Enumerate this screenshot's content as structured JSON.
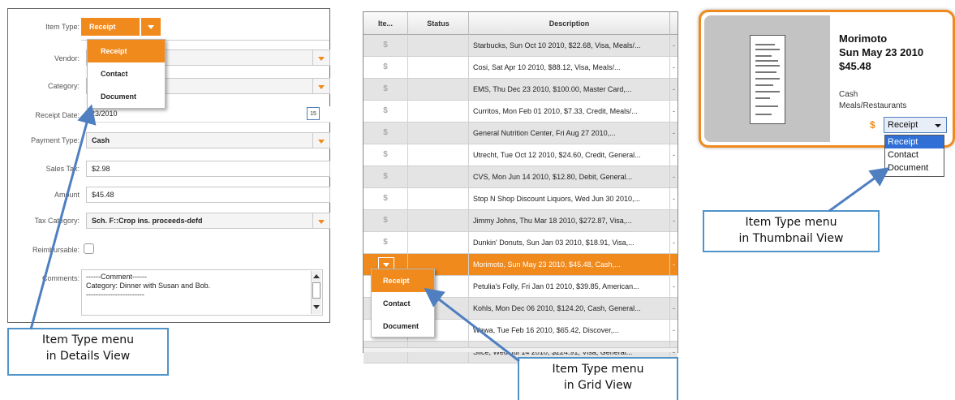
{
  "details": {
    "labels": {
      "item_type": "Item Type:",
      "vendor": "Vendor:",
      "category": "Category:",
      "receipt_date": "Receipt Date:",
      "payment_type": "Payment Type:",
      "sales_tax": "Sales Tax:",
      "amount": "Amount",
      "tax_category": "Tax Category:",
      "reimbursable": "Reimbursable:",
      "comments": "Comments:"
    },
    "item_type_value": "Receipt",
    "receipt_date_value": "23/2010",
    "payment_type_value": "Cash",
    "sales_tax_value": "$2.98",
    "amount_value": "$45.48",
    "tax_category_value": "Sch. F::Crop ins. proceeds-defd",
    "calendar_day": "15",
    "comments_lines": [
      "------Comment------",
      "Category: Dinner with Susan and Bob.",
      "------------------------"
    ],
    "menu": [
      "Receipt",
      "Contact",
      "Document"
    ],
    "callout": [
      "Item Type menu",
      "in Details View"
    ]
  },
  "grid": {
    "headers": [
      "Ite...",
      "Status",
      "Description"
    ],
    "rows": [
      {
        "icon": "$",
        "desc": "Starbucks, Sun Oct 10 2010, $22.68, Visa, Meals/...",
        "end": "-"
      },
      {
        "icon": "$",
        "desc": "Cosi, Sat Apr 10 2010, $88.12, Visa, Meals/...",
        "end": "-"
      },
      {
        "icon": "$",
        "desc": "EMS, Thu Dec 23 2010, $100.00, Master Card,...",
        "end": "-"
      },
      {
        "icon": "$",
        "desc": "Curritos, Mon Feb 01 2010, $7.33, Credit, Meals/...",
        "end": "-"
      },
      {
        "icon": "$",
        "desc": "General Nutrition Center, Fri Aug 27 2010,...",
        "end": "-"
      },
      {
        "icon": "$",
        "desc": "Utrecht, Tue Oct 12 2010, $24.60, Credit, General...",
        "end": "-"
      },
      {
        "icon": "$",
        "desc": "CVS, Mon Jun 14 2010, $12.80, Debit, General...",
        "end": "-"
      },
      {
        "icon": "$",
        "desc": "Stop N Shop Discount Liquors, Wed Jun 30 2010,...",
        "end": "-"
      },
      {
        "icon": "$",
        "desc": "Jimmy Johns, Thu Mar 18 2010, $272.87, Visa,...",
        "end": "-"
      },
      {
        "icon": "$",
        "desc": "Dunkin' Donuts, Sun Jan 03 2010, $18.91, Visa,...",
        "end": "-"
      },
      {
        "icon": "",
        "desc": "Morimoto, Sun May 23 2010, $45.48, Cash,...",
        "end": "-"
      },
      {
        "icon": "",
        "desc": "Petulia's Folly, Fri Jan 01 2010, $39.85, American...",
        "end": "-"
      },
      {
        "icon": "",
        "desc": "Kohls, Mon Dec 06 2010, $124.20, Cash, General...",
        "end": "-"
      },
      {
        "icon": "",
        "desc": "Wawa, Tue Feb 16 2010, $65.42, Discover,...",
        "end": "-"
      },
      {
        "icon": "",
        "desc": "Slice, Wed Jul 14 2010, $224.91, Visa, General...",
        "end": "-"
      }
    ],
    "menu": [
      "Receipt",
      "Contact",
      "Document"
    ],
    "callout": [
      "Item Type menu",
      "in Grid View"
    ]
  },
  "thumbnail": {
    "vendor": "Morimoto",
    "date": "Sun May 23 2010",
    "amount": "$45.48",
    "payment": "Cash",
    "category": "Meals/Restaurants",
    "dollar_icon": "$",
    "select_value": "Receipt",
    "menu": [
      "Receipt",
      "Contact",
      "Document"
    ],
    "callout": [
      "Item Type menu",
      "in Thumbnail View"
    ]
  },
  "colors": {
    "accent": "#f08a1c",
    "callout_border": "#4f93c9",
    "arrow": "#4f7fc0"
  }
}
